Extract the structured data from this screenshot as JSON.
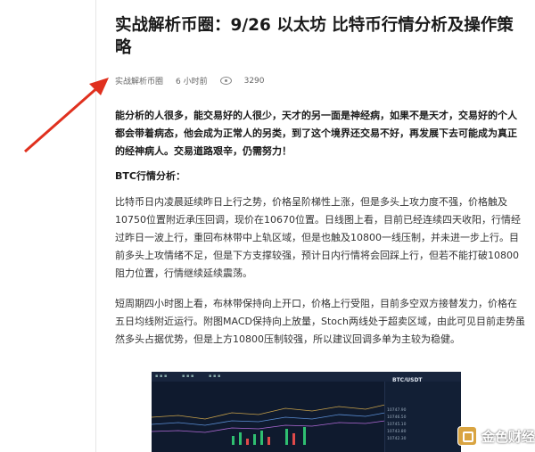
{
  "article": {
    "title": "实战解析币圈：9/26 以太坊 比特币行情分析及操作策略",
    "author": "实战解析币圈",
    "time": "6 小时前",
    "views": "3290",
    "intro": "能分析的人很多，能交易好的人很少，天才的另一面是神经病，如果不是天才，交易好的个人都会带着病态，他会成为正常人的另类，到了这个境界还交易不好，再发展下去可能成为真正的经神病人。交易道路艰辛，仍需努力！",
    "section_heading": "BTC行情分析：",
    "para1": "比特币日内凌晨延续昨日上行之势，价格呈阶梯性上涨，但是多头上攻力度不强，价格触及10750位置附近承压回调，现价在10670位置。日线图上看，目前已经连续四天收阳，行情经过昨日一波上行，重回布林带中上轨区域，但是也触及10800一线压制，并未进一步上行。目前多头上攻情绪不足，但是下方支撑较强，预计日内行情将会回踩上行，但若不能打破10800阻力位置，行情继续延续震荡。",
    "para2": "短周期四小时图上看，布林带保持向上开口，价格上行受阻，目前多空双方接替发力，价格在五日均线附近运行。附图MACD保持向上放量，Stoch两线处于超卖区域，由此可见目前走势虽然多头占据优势，但是上方10800压制较强，所以建议回调多单为主较为稳健。"
  },
  "chart_image": {
    "pair": "BTC/USDT",
    "rows": [
      "10747.90",
      "10746.50",
      "10745.10",
      "10743.80",
      "10742.30"
    ]
  },
  "watermark": {
    "text": "金色财经"
  },
  "colors": {
    "arrow": "#e0301e",
    "up": "#2fbf71",
    "down": "#e04a4a"
  }
}
